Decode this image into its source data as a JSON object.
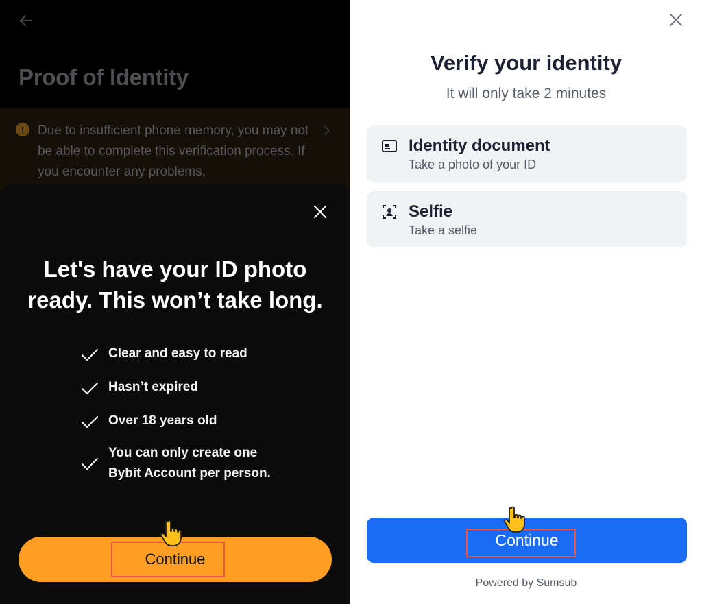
{
  "left_panel": {
    "page_title": "Proof of Identity",
    "warning_text": "Due to insufficient phone memory, you may not be able to complete this verification process. If you encounter any problems,",
    "sheet": {
      "heading": "Let's have your ID photo ready. This won’t take long.",
      "checklist": [
        "Clear and easy to read",
        "Hasn’t expired",
        "Over 18 years old",
        "You can only create one Bybit Account per person."
      ],
      "continue_label": "Continue"
    },
    "colors": {
      "accent": "#ff9e22",
      "background": "#000000"
    },
    "icons": [
      "back-arrow-icon",
      "warning-icon",
      "chevron-right-icon",
      "close-icon",
      "check-icon",
      "pointing-hand-icon"
    ]
  },
  "right_panel": {
    "title": "Verify your identity",
    "subtitle": "It will only take 2 minutes",
    "steps": [
      {
        "title": "Identity document",
        "subtitle": "Take a photo of your ID",
        "icon": "id-card-icon"
      },
      {
        "title": "Selfie",
        "subtitle": "Take a selfie",
        "icon": "selfie-frame-icon"
      }
    ],
    "continue_label": "Continue",
    "powered_by": "Powered by Sumsub",
    "colors": {
      "accent": "#1a6cf6",
      "highlight_box": "#e8574d"
    },
    "icons": [
      "close-icon",
      "pointing-hand-icon"
    ]
  }
}
